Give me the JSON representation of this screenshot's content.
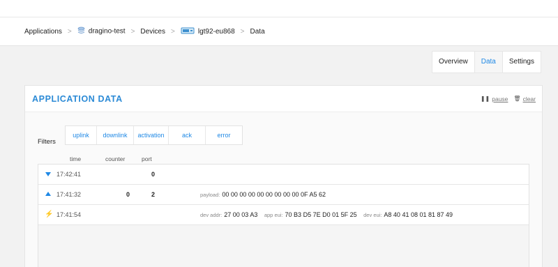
{
  "breadcrumb": {
    "items": [
      {
        "label": "Applications",
        "icon": null
      },
      {
        "label": "dragino-test",
        "icon": "app-stack-icon"
      },
      {
        "label": "Devices",
        "icon": null
      },
      {
        "label": "lgt92-eu868",
        "icon": "device-icon"
      },
      {
        "label": "Data",
        "icon": null
      }
    ],
    "separator": ">"
  },
  "tabs": [
    {
      "label": "Overview",
      "active": false
    },
    {
      "label": "Data",
      "active": true
    },
    {
      "label": "Settings",
      "active": false
    }
  ],
  "panel": {
    "title": "APPLICATION DATA",
    "pause_label": "pause",
    "clear_label": "clear"
  },
  "filters": {
    "label": "Filters",
    "buttons": [
      "uplink",
      "downlink",
      "activation",
      "ack",
      "error"
    ]
  },
  "columns": {
    "time": "time",
    "counter": "counter",
    "port": "port"
  },
  "rows": [
    {
      "type": "downlink",
      "time": "17:42:41",
      "counter": "",
      "port": "0"
    },
    {
      "type": "uplink",
      "time": "17:41:32",
      "counter": "0",
      "port": "2",
      "payload_label": "payload:",
      "payload": "00 00 00 00 00 00 00 00 00 0F A5 62"
    },
    {
      "type": "activation",
      "time": "17:41:54",
      "dev_addr_label": "dev addr:",
      "dev_addr": "27 00 03 A3",
      "app_eui_label": "app eui:",
      "app_eui": "70 B3 D5 7E D0 01 5F 25",
      "dev_eui_label": "dev eui:",
      "dev_eui": "A8 40 41 08 01 81 87 49"
    }
  ],
  "colors": {
    "accent": "#1e88e5",
    "title": "#2b8ad6",
    "activation": "#f5b400"
  }
}
